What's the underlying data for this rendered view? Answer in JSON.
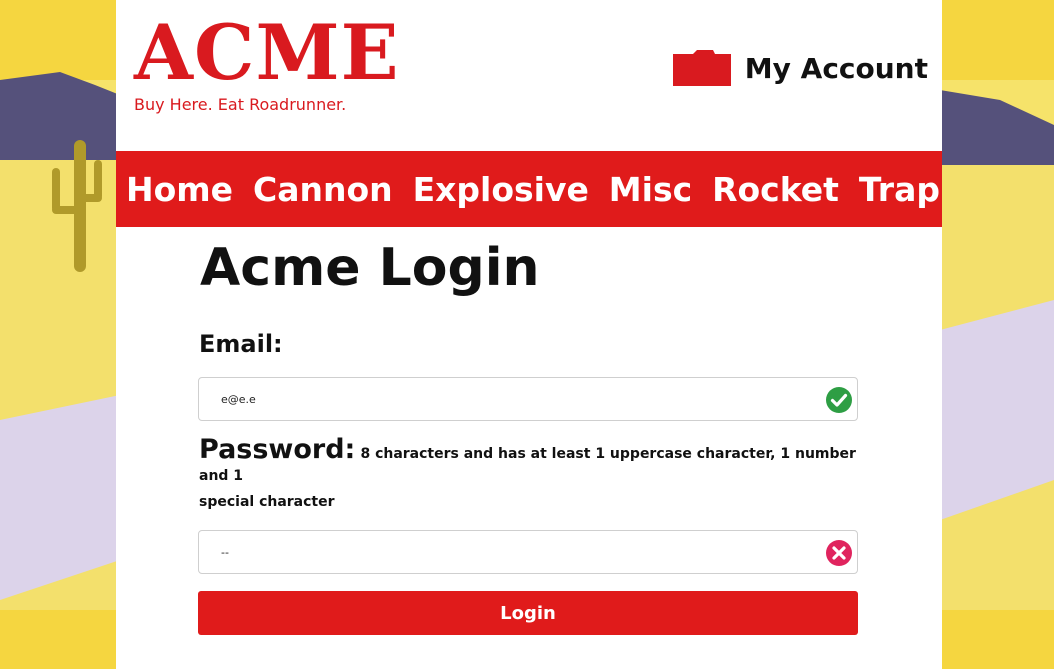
{
  "brand": {
    "name": "ACME",
    "tagline": "Buy Here. Eat Roadrunner.",
    "color": "#d91a1f"
  },
  "header": {
    "account_label": "My Account",
    "account_icon": "folder-icon"
  },
  "nav": {
    "items": [
      "Home",
      "Cannon",
      "Explosive",
      "Misc",
      "Rocket",
      "Trap"
    ],
    "background": "#e01b1b"
  },
  "login": {
    "title": "Acme Login",
    "email_label": "Email:",
    "email_value": "e@e.e",
    "email_status": "valid",
    "password_label": "Password:",
    "password_hint_1": "8 characters and has at least 1 uppercase character, 1 number and 1",
    "password_hint_2": "special character",
    "password_value": "--",
    "password_status": "invalid",
    "button_label": "Login"
  },
  "colors": {
    "valid": "#2e9e44",
    "invalid": "#e0245e",
    "background_yellow": "#f4df4a",
    "background_lavender": "#d9d2e9"
  }
}
